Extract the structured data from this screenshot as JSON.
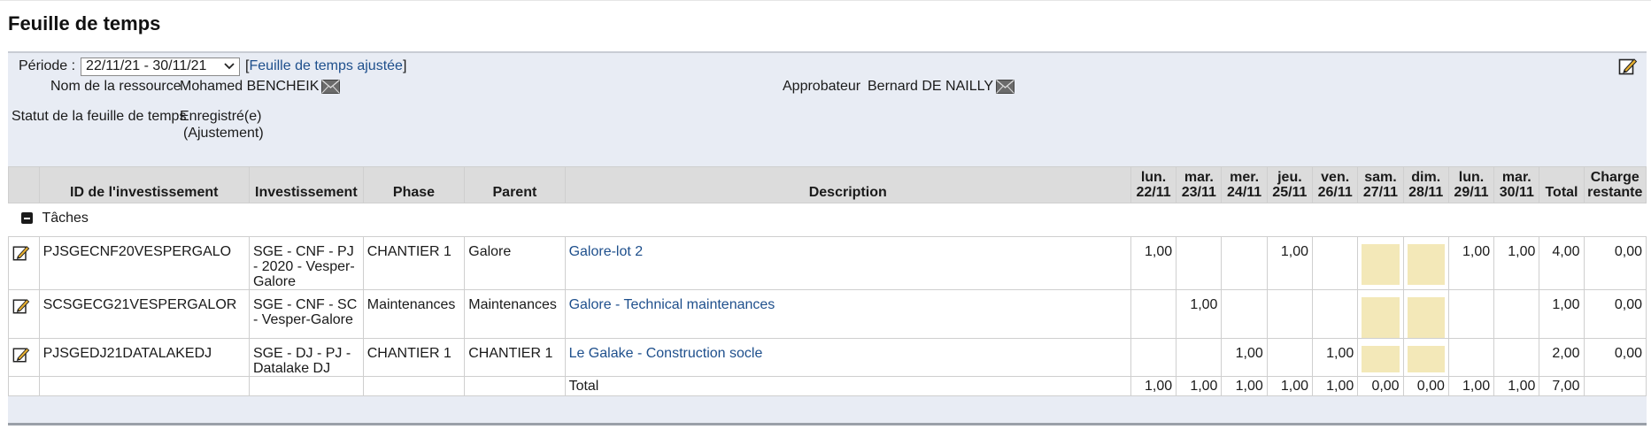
{
  "title": "Feuille de temps",
  "period": {
    "label": "Période :",
    "selected": "22/11/21 - 30/11/21",
    "adjusted_link": "Feuille de temps ajustée",
    "bracket_open": "[",
    "bracket_close": "]"
  },
  "resource": {
    "label": "Nom de la ressource",
    "value": "Mohamed BENCHEIK"
  },
  "approver": {
    "label": "Approbateur",
    "value": "Bernard DE NAILLY"
  },
  "status": {
    "label": "Statut de la feuille de temps",
    "value_line1": "Enregistré(e)",
    "value_line2": "(Ajustement)"
  },
  "columns": {
    "id": "ID de l'investissement",
    "investment": "Investissement",
    "phase": "Phase",
    "parent": "Parent",
    "description": "Description",
    "days": [
      {
        "d": "lun.",
        "date": "22/11"
      },
      {
        "d": "mar.",
        "date": "23/11"
      },
      {
        "d": "mer.",
        "date": "24/11"
      },
      {
        "d": "jeu.",
        "date": "25/11"
      },
      {
        "d": "ven.",
        "date": "26/11"
      },
      {
        "d": "sam.",
        "date": "27/11"
      },
      {
        "d": "dim.",
        "date": "28/11"
      },
      {
        "d": "lun.",
        "date": "29/11"
      },
      {
        "d": "mar.",
        "date": "30/11"
      }
    ],
    "total": "Total",
    "remaining_line1": "Charge",
    "remaining_line2": "restante"
  },
  "section": {
    "name": "Tâches"
  },
  "rows": [
    {
      "id": "PJSGECNF20VESPERGALO",
      "investment": "SGE - CNF - PJ - 2020 - Vesper-Galore",
      "phase": "CHANTIER 1",
      "parent": "Galore",
      "description": "Galore-lot 2",
      "days": [
        "1,00",
        "",
        "",
        "1,00",
        "",
        "",
        "",
        "1,00",
        "1,00"
      ],
      "total": "4,00",
      "remaining": "0,00"
    },
    {
      "id": "SCSGECG21VESPERGALOR",
      "investment": "SGE - CNF - SC - Vesper-Galore",
      "phase": "Maintenances",
      "parent": "Maintenances",
      "description": "Galore - Technical maintenances",
      "days": [
        "",
        "1,00",
        "",
        "",
        "",
        "",
        "",
        "",
        ""
      ],
      "total": "1,00",
      "remaining": "0,00"
    },
    {
      "id": "PJSGEDJ21DATALAKEDJ",
      "investment": "SGE - DJ - PJ - Datalake DJ",
      "phase": "CHANTIER 1",
      "parent": "CHANTIER 1",
      "description": "Le Galake - Construction socle",
      "days": [
        "",
        "",
        "1,00",
        "",
        "1,00",
        "",
        "",
        "",
        ""
      ],
      "total": "2,00",
      "remaining": "0,00"
    }
  ],
  "totals": {
    "label": "Total",
    "days": [
      "1,00",
      "1,00",
      "1,00",
      "1,00",
      "1,00",
      "0,00",
      "0,00",
      "1,00",
      "1,00"
    ],
    "total": "7,00"
  },
  "colors": {
    "panel_bg": "#e8ecf4",
    "header_bg": "#dcdcdc",
    "weekend_fill": "#f3e8b8",
    "link": "#1e4f8c"
  },
  "icons": {
    "edit": "edit-note-icon",
    "mail": "envelope-icon",
    "collapse": "minus-square-icon"
  }
}
